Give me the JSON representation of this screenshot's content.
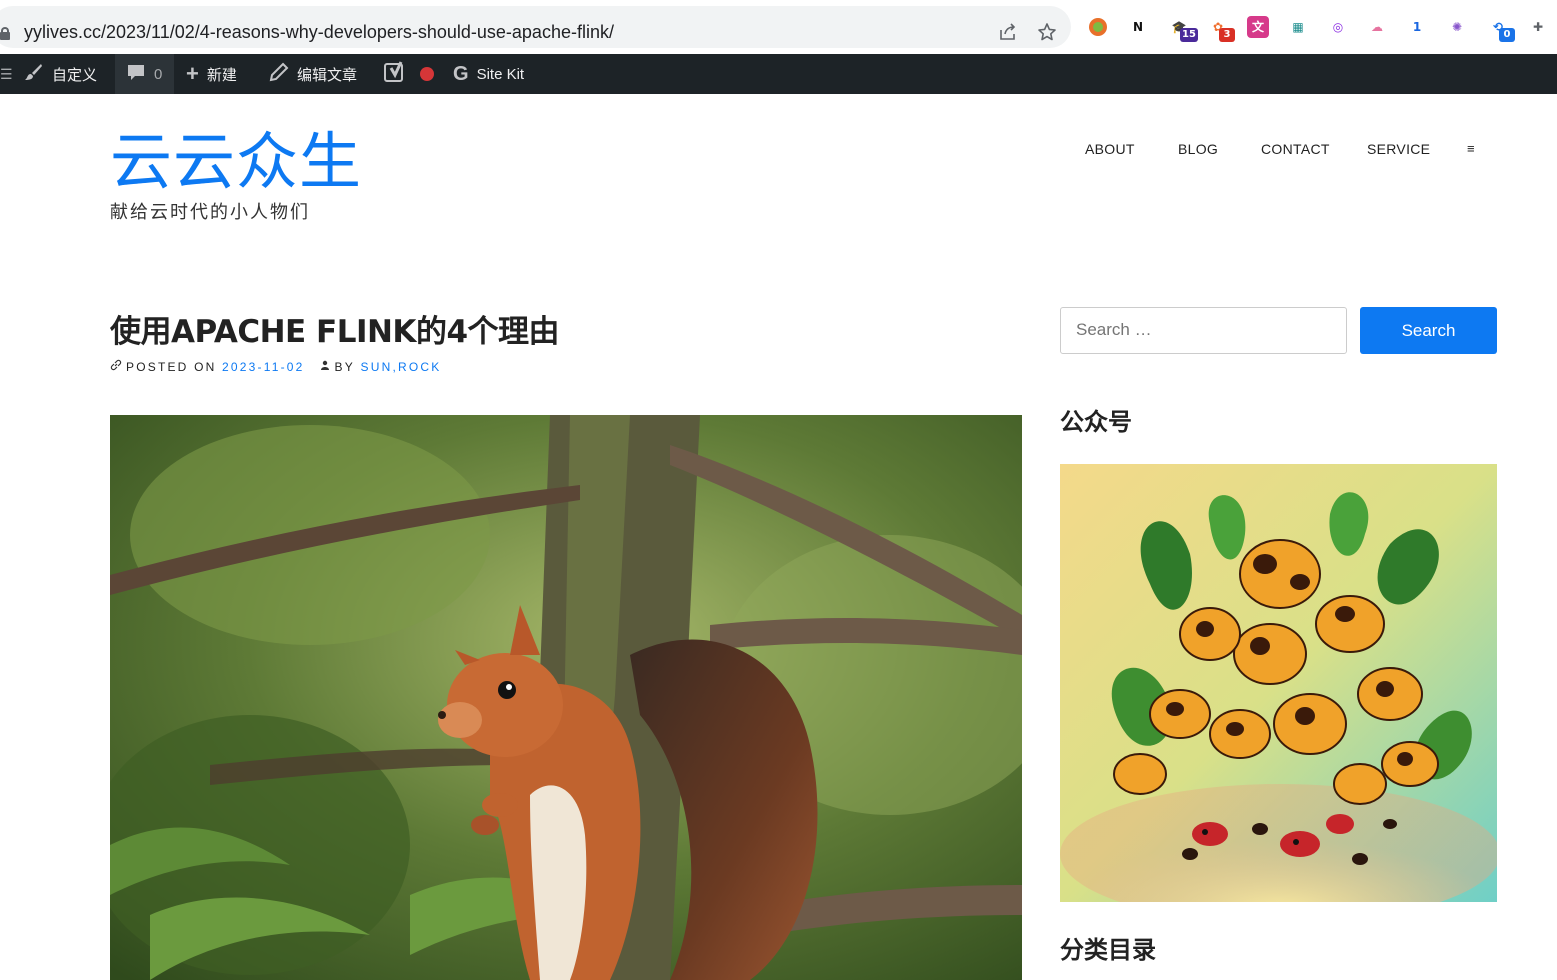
{
  "browser": {
    "url": "yylives.cc/2023/11/02/4-reasons-why-developers-should-use-apache-flink/",
    "share_icon": "share-icon",
    "bookmark_icon": "star-icon",
    "extensions": [
      {
        "name": "circle-extension-icon",
        "glyph": "",
        "badge": "",
        "bg": "#ffffff",
        "fg": "#e8702a"
      },
      {
        "name": "notion-extension-icon",
        "glyph": "N",
        "badge": "",
        "bg": "#ffffff",
        "fg": "#111111"
      },
      {
        "name": "graduation-cap-extension-icon",
        "glyph": "🎓",
        "badge": "15",
        "bg": "#ffffff",
        "fg": "#5b2bbd"
      },
      {
        "name": "flower-extension-icon",
        "glyph": "✿",
        "badge": "3",
        "bg": "#ffffff",
        "fg": "#f07030"
      },
      {
        "name": "translate-extension-icon",
        "glyph": "文",
        "badge": "",
        "bg": "#d63a8a",
        "fg": "#ffffff"
      },
      {
        "name": "grid-extension-icon",
        "glyph": "▦",
        "badge": "",
        "bg": "#ffffff",
        "fg": "#1a8c8c"
      },
      {
        "name": "lr-extension-icon",
        "glyph": "◎",
        "badge": "",
        "bg": "#ffffff",
        "fg": "#8a2be2"
      },
      {
        "name": "cloud-extension-icon",
        "glyph": "☁",
        "badge": "",
        "bg": "#ffffff",
        "fg": "#e6739f"
      },
      {
        "name": "number-one-extension-icon",
        "glyph": "1",
        "badge": "",
        "bg": "#ffffff",
        "fg": "#1a66e0"
      },
      {
        "name": "openai-extension-icon",
        "glyph": "✺",
        "badge": "",
        "bg": "#ffffff",
        "fg": "#8855cc"
      },
      {
        "name": "refresh-extension-icon",
        "glyph": "⟲",
        "badge": "0",
        "bg": "#ffffff",
        "fg": "#1a73e8"
      },
      {
        "name": "puzzle-extensions-icon",
        "glyph": "✚",
        "badge": "",
        "bg": "#ffffff",
        "fg": "#5f6368"
      }
    ]
  },
  "adminbar": {
    "customize": "自定义",
    "comments_count": "0",
    "new": "新建",
    "edit_post": "编辑文章",
    "sitekit": "Site Kit"
  },
  "site": {
    "title": "云云众生",
    "description": "献给云时代的小人物们"
  },
  "nav": [
    "ABOUT",
    "BLOG",
    "CONTACT",
    "SERVICE",
    "≡"
  ],
  "post": {
    "title": "使用APACHE FLINK的4个理由",
    "posted_on_label": "POSTED ON",
    "date": "2023-11-02",
    "by_label": "BY",
    "author1": "SUN",
    "author_sep": ", ",
    "author2": "ROCK"
  },
  "sidebar": {
    "search_placeholder": "Search …",
    "search_button": "Search",
    "wechat_title": "公众号",
    "categories_title": "分类目录"
  },
  "colors": {
    "accent": "#0d79f2",
    "adminbar_bg": "#1d2327"
  }
}
